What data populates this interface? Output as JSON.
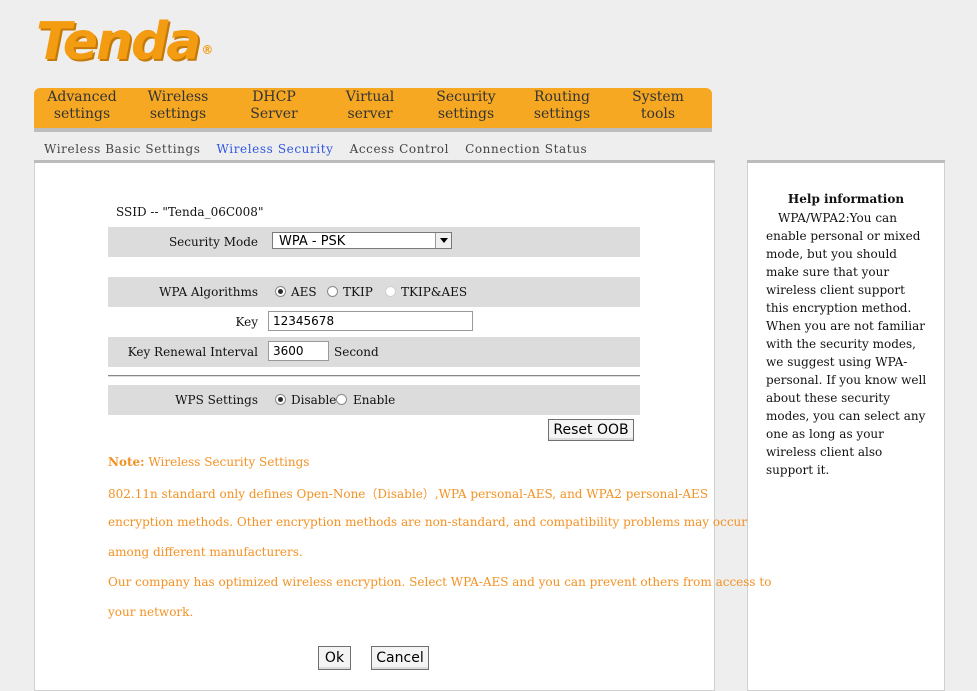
{
  "brand": {
    "logo_text": "Tenda",
    "logo_mark": "®",
    "brand_color": "#f39c12"
  },
  "main_nav": [
    {
      "label": "Advanced\nsettings"
    },
    {
      "label": "Wireless\nsettings"
    },
    {
      "label": "DHCP\nServer"
    },
    {
      "label": "Virtual\nserver"
    },
    {
      "label": "Security\nsettings"
    },
    {
      "label": "Routing\nsettings"
    },
    {
      "label": "System\ntools"
    }
  ],
  "sub_nav": [
    {
      "label": "Wireless Basic Settings"
    },
    {
      "label": "Wireless Security",
      "active": true
    },
    {
      "label": "Access Control"
    },
    {
      "label": "Connection Status"
    }
  ],
  "form": {
    "ssid_text": "SSID -- \"Tenda_06C008\"",
    "security_mode_label": "Security Mode",
    "security_mode_value": "WPA - PSK",
    "wpa_algorithms_label": "WPA Algorithms",
    "algorithm_options": [
      "AES",
      "TKIP",
      "TKIP&AES"
    ],
    "algorithm_selected": "AES",
    "key_label": "Key",
    "key_value": "12345678",
    "renewal_label": "Key Renewal Interval",
    "renewal_value": "3600",
    "renewal_unit": "Second",
    "wps_label": "WPS Settings",
    "wps_options": [
      "Disable",
      "Enable"
    ],
    "wps_selected": "Disable",
    "reset_button": "Reset OOB",
    "ok_button": "Ok",
    "cancel_button": "Cancel"
  },
  "note": {
    "prefix": "Note:",
    "title": " Wireless Security Settings",
    "lines": [
      "802.11n standard only defines Open-None（Disable）,WPA personal-AES, and WPA2 personal-AES",
      "encryption methods. Other encryption methods are non-standard, and compatibility problems may occur",
      "among different manufacturers.",
      "Our company has optimized wireless encryption. Select WPA-AES and you can prevent others from access to",
      "your network."
    ],
    "color": "#f39224"
  },
  "help": {
    "title": "Help information",
    "text": "WPA/WPA2:You can enable personal or mixed mode, but you should make sure that your wireless client support this encryption method. When you are not familiar with the security modes, we suggest using WPA-personal. If you know well about these security modes, you can select any one as long as your wireless client also support it."
  }
}
